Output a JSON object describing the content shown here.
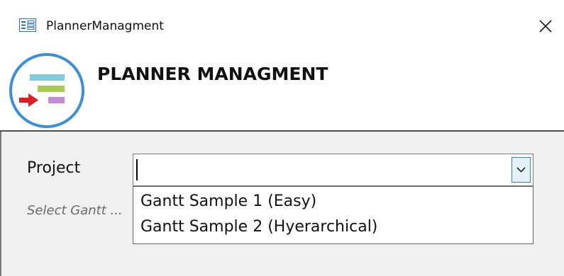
{
  "window": {
    "title": "PlannerManagment",
    "app_icon": "form-icon",
    "close_icon": "close-icon"
  },
  "header": {
    "heading": "PLANNER MANAGMENT",
    "logo": "planner-logo"
  },
  "form": {
    "project_label": "Project",
    "hint": "Select Gantt ...",
    "project_combo": {
      "value": "",
      "dropdown_icon": "chevron-down-icon",
      "options": [
        "Gantt Sample 1 (Easy)",
        "Gantt Sample 2 (Hyerarchical)"
      ]
    }
  },
  "colors": {
    "logo_ring": "#3a8fd6",
    "bar_top": "#7ecbe0",
    "bar_middle": "#a9c94f",
    "bar_bottom": "#c48ad6",
    "arrow": "#e11b22",
    "form_background": "#f0f0f0"
  }
}
